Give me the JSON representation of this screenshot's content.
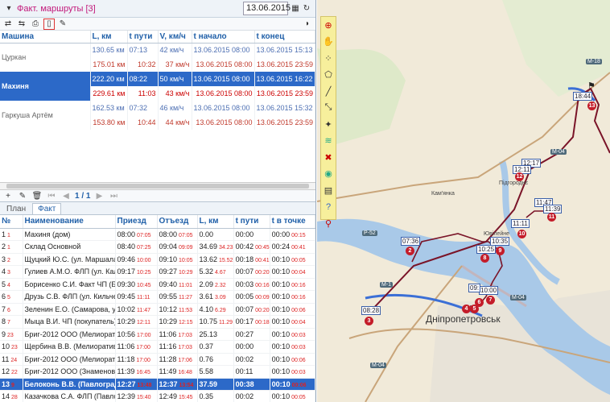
{
  "header": {
    "title": "Факт. маршруты [3]",
    "date": "13.06.2015"
  },
  "cars": {
    "columns": [
      "Машина",
      "L, км",
      "t пути",
      "V, км/ч",
      "t начало",
      "t конец"
    ],
    "rows": [
      {
        "name": "Цуркан",
        "a": [
          "130.65 км",
          "07:13",
          "42 км/ч",
          "13.06.2015 08:00",
          "13.06.2015 15:13"
        ],
        "b": [
          "175.01 км",
          "10:32",
          "37 км/ч",
          "13.06.2015 08:00",
          "13.06.2015 23:59"
        ]
      },
      {
        "name": "Махиня",
        "a": [
          "222.20 км",
          "08:22",
          "50 км/ч",
          "13.06.2015 08:00",
          "13.06.2015 16:22"
        ],
        "b": [
          "229.61 км",
          "11:03",
          "43 км/ч",
          "13.06.2015 08:00",
          "13.06.2015 23:59"
        ]
      },
      {
        "name": "Гаркуша Артём",
        "a": [
          "162.53 км",
          "07:32",
          "46 км/ч",
          "13.06.2015 08:00",
          "13.06.2015 15:32"
        ],
        "b": [
          "153.80 км",
          "10:44",
          "44 км/ч",
          "13.06.2015 08:00",
          "13.06.2015 23:59"
        ]
      }
    ]
  },
  "pager": {
    "text": "1 / 1"
  },
  "tabs": [
    "План",
    "Факт"
  ],
  "points": {
    "columns": [
      "№",
      "Наименование",
      "Приезд",
      "Отъезд",
      "L, км",
      "t пути",
      "t в точке"
    ],
    "rows": [
      {
        "n": "1",
        "i": "1",
        "name": "Махиня (дом)",
        "arr": "08:00",
        "arrp": "07:05",
        "dep": "08:00",
        "depp": "07:05",
        "l": "0.00",
        "lp": "",
        "t": "00:00",
        "tp": "",
        "tt": "00:00",
        "ttp": "00:15"
      },
      {
        "n": "2",
        "i": "1",
        "name": "Склад Основной",
        "arr": "08:40",
        "arrp": "07:25",
        "dep": "09:04",
        "depp": "09:09",
        "l": "34.69",
        "lp": "34.23",
        "t": "00:42",
        "tp": "00:45",
        "tt": "00:24",
        "ttp": "00:41"
      },
      {
        "n": "3",
        "i": "2",
        "name": "Щуцкий Ю.С. (ул. Маршала М",
        "arr": "09:46",
        "arrp": "10:00",
        "dep": "09:10",
        "depp": "10:05",
        "l": "13.62",
        "lp": "15.52",
        "t": "00:18",
        "tp": "00:41",
        "tt": "00:10",
        "ttp": "00:05"
      },
      {
        "n": "4",
        "i": "3",
        "name": "Гулиев А.М.О. ФЛП (ул. Кали",
        "arr": "09:17",
        "arrp": "10:25",
        "dep": "09:27",
        "depp": "10:29",
        "l": "5.32",
        "lp": "4.67",
        "t": "00:07",
        "tp": "00:20",
        "tt": "00:10",
        "ttp": "00:04"
      },
      {
        "n": "5",
        "i": "4",
        "name": "Борисенко С.И. Факт ЧП (Бай",
        "arr": "09:30",
        "arrp": "10:45",
        "dep": "09:40",
        "depp": "11:01",
        "l": "2.09",
        "lp": "2.32",
        "t": "00:03",
        "tp": "00:16",
        "tt": "00:10",
        "ttp": "00:16"
      },
      {
        "n": "6",
        "i": "5",
        "name": "Друзь С.В. ФЛП (ул. Кильчен",
        "arr": "09:45",
        "arrp": "11:11",
        "dep": "09:55",
        "depp": "11:27",
        "l": "3.61",
        "lp": "3.09",
        "t": "00:05",
        "tp": "00:09",
        "tt": "00:10",
        "ttp": "00:16"
      },
      {
        "n": "7",
        "i": "6",
        "name": "Зеленин Е.О. (Самарова, ул",
        "arr": "10:02",
        "arrp": "11:47",
        "dep": "10:12",
        "depp": "11:53",
        "l": "4.10",
        "lp": "6.29",
        "t": "00:07",
        "tp": "00:20",
        "tt": "00:10",
        "ttp": "00:06"
      },
      {
        "n": "8",
        "i": "7",
        "name": "Мыца В.И. ЧП (покупатель)",
        "arr": "10:29",
        "arrp": "12:11",
        "dep": "10:29",
        "depp": "12:15",
        "l": "10.75",
        "lp": "11.29",
        "t": "00:17",
        "tp": "00:18",
        "tt": "00:10",
        "ttp": "00:04"
      },
      {
        "n": "9",
        "i": "23",
        "name": "Бриг-2012 ООО (Мелиоратив",
        "arr": "10:56",
        "arrp": "17:00",
        "dep": "11:06",
        "depp": "17:03",
        "l": "25.13",
        "lp": "",
        "t": "00:27",
        "tp": "",
        "tt": "00:10",
        "ttp": "00:03"
      },
      {
        "n": "10",
        "i": "23",
        "name": "Щербина В.В. (Мелиоративн",
        "arr": "11:06",
        "arrp": "17:00",
        "dep": "11:16",
        "depp": "17:03",
        "l": "0.37",
        "lp": "",
        "t": "00:00",
        "tp": "",
        "tt": "00:10",
        "ttp": "00:03"
      },
      {
        "n": "11",
        "i": "24",
        "name": "Бриг-2012 ООО (Мелиоратив",
        "arr": "11:18",
        "arrp": "17:00",
        "dep": "11:28",
        "depp": "17:06",
        "l": "0.76",
        "lp": "",
        "t": "00:02",
        "tp": "",
        "tt": "00:10",
        "ttp": "00:06"
      },
      {
        "n": "12",
        "i": "22",
        "name": "Бриг-2012 ООО (Знаменовка",
        "arr": "11:39",
        "arrp": "16:45",
        "dep": "11:49",
        "depp": "16:48",
        "l": "5.58",
        "lp": "",
        "t": "00:11",
        "tp": "",
        "tt": "00:10",
        "ttp": "00:03"
      },
      {
        "n": "13",
        "i": "9",
        "name": "Белоконь В.В. (Павлоград, ул",
        "arr": "12:27",
        "arrp": "13:48",
        "dep": "12:37",
        "depp": "13:54",
        "l": "37.59",
        "lp": "",
        "t": "00:38",
        "tp": "",
        "tt": "00:10",
        "ttp": "00:06"
      },
      {
        "n": "14",
        "i": "28",
        "name": "Казачкова С.А. ФЛП (Павлог",
        "arr": "12:39",
        "arrp": "15:40",
        "dep": "12:49",
        "depp": "15:45",
        "l": "0.35",
        "lp": "",
        "t": "00:02",
        "tp": "",
        "tt": "00:10",
        "ttp": "00:05"
      }
    ]
  },
  "map": {
    "labels": {
      "city": "Дніпропетровськ",
      "town1": "Підгороднє",
      "town2": "Ювілейне",
      "town3": "Кам'янка"
    },
    "roads": [
      "M-18",
      "P-52",
      "M-04",
      "M-04",
      "M-04",
      "M-1"
    ],
    "time_labels": [
      "18:44",
      "12:17",
      "12:11",
      "11:47",
      "11:39",
      "11:11",
      "10:35",
      "10:25",
      "10:00",
      "09:",
      "07:36",
      "08:28"
    ],
    "markers": [
      "13",
      "10",
      "11",
      "9",
      "8",
      "7",
      "6",
      "5",
      "4",
      "3",
      "2",
      "12"
    ]
  }
}
